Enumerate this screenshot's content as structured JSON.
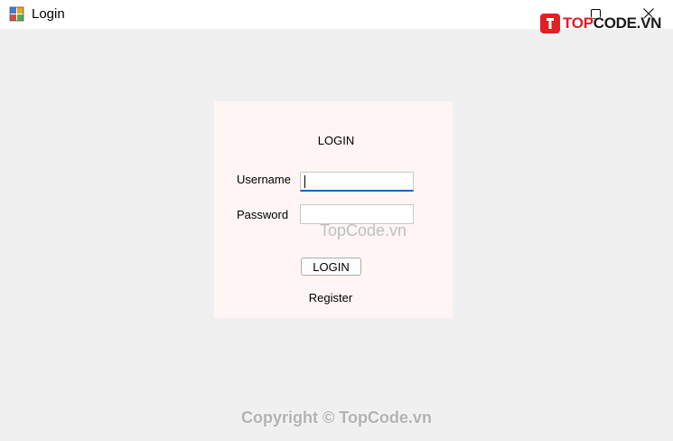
{
  "window": {
    "title": "Login",
    "icons": {
      "app": "app-window-icon",
      "minimize": "minimize-icon",
      "maximize": "maximize-icon",
      "close": "close-icon"
    }
  },
  "logo": {
    "text_main": "TOP",
    "text_rest": "CODE.VN",
    "accent_color": "#e31e24"
  },
  "form": {
    "title": "LOGIN",
    "username_label": "Username",
    "username_value": "",
    "password_label": "Password",
    "password_value": "",
    "login_button": "LOGIN",
    "register_link": "Register",
    "focus_color": "#0067c0",
    "panel_color": "#fff5f5"
  },
  "watermarks": {
    "center": "TopCode.vn",
    "bottom": "Copyright © TopCode.vn"
  }
}
